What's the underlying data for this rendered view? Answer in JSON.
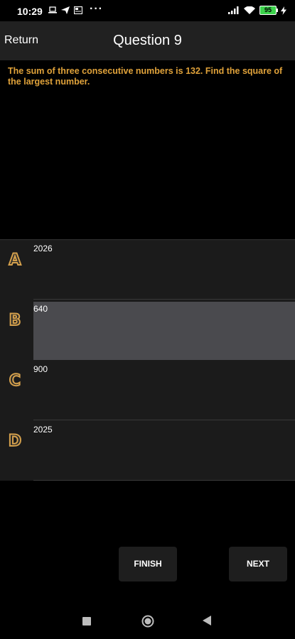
{
  "status_bar": {
    "time": "10:29",
    "dots": "···",
    "battery": "95",
    "icons": [
      "laptop-icon",
      "send-icon",
      "news-icon",
      "signal-icon",
      "wifi-icon",
      "battery-icon",
      "charging-icon"
    ]
  },
  "app_bar": {
    "return_label": "Return",
    "title": "Question 9"
  },
  "question": {
    "text": "The sum of three consecutive numbers is 132. Find the square of the largest number."
  },
  "options": [
    {
      "letter": "A",
      "text": "2026",
      "selected": false
    },
    {
      "letter": "B",
      "text": "640",
      "selected": true
    },
    {
      "letter": "C",
      "text": "900",
      "selected": false
    },
    {
      "letter": "D",
      "text": "2025",
      "selected": false
    }
  ],
  "buttons": {
    "finish_label": "FINISH",
    "next_label": "NEXT"
  },
  "colors": {
    "question_text": "#e0a23a",
    "appbar_bg": "#212121",
    "option_bg": "#1b1b1b",
    "selected_bg": "#4a4a4e",
    "letter_gold": "#d4a04c"
  }
}
